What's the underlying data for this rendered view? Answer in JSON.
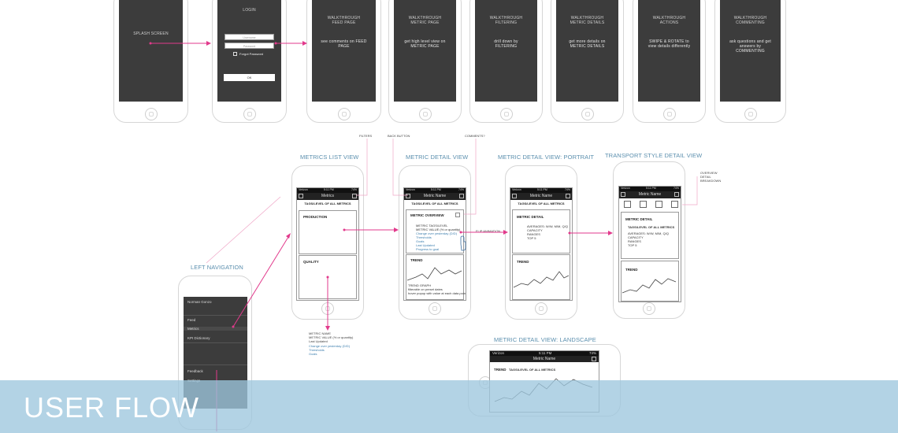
{
  "colors": {
    "arrow": "#e23a8c",
    "label": "#5b8fae",
    "banner": "#9ec7de",
    "link": "#3d7fae"
  },
  "walkthrough": [
    {
      "t1": "SPLASH SCREEN",
      "t2": ""
    },
    {
      "t1": "LOGIN",
      "t2": ""
    },
    {
      "t1": "WALKTHROUGH FEED PAGE",
      "t2": "see comments on FEED PAGE"
    },
    {
      "t1": "WALKTHROUGH METRIC PAGE",
      "t2": "get high level view on METRIC PAGE"
    },
    {
      "t1": "WALKTHROUGH FILTERING",
      "t2": "drill down by FILTERING"
    },
    {
      "t1": "WALKTHROUGH METRIC DETAILS",
      "t2": "get more details on METRIC DETAILS"
    },
    {
      "t1": "WALKTHROUGH ACTIONS",
      "t2": "SWIPE & ROTATE to view details differently"
    },
    {
      "t1": "WALKTHROUGH COMMENTING",
      "t2": "ask questions and get answers by COMMENTING"
    }
  ],
  "login": {
    "username": "Username",
    "password": "Password",
    "forgot": "Forgot Password",
    "ok": "OK"
  },
  "labels": {
    "metrics_list": "METRICS LIST VIEW",
    "metric_detail": "METRIC DETAIL VIEW",
    "detail_portrait": "METRIC DETAIL VIEW: PORTRAIT",
    "transport": "TRANSPORT STYLE DETAIL VIEW",
    "left_nav": "LEFT NAVIGATION",
    "landscape": "METRIC DETAIL VIEW:  LANDSCAPE"
  },
  "callouts": {
    "filters": "FILTERS",
    "back": "BACK BUTTON",
    "comments": "COMMENTS?",
    "flip": "FLIP ANIMATION",
    "overview1": "OVERVIEW",
    "overview2": "DETAIL",
    "overview3": "BREAKDOWN"
  },
  "screens": {
    "metrics_title": "Metrics",
    "metric_name": "Metric Name",
    "tags": "TAGS/LEVEL OF ALL METRICS",
    "production": "PRODUCTION",
    "quality": "QUALITY",
    "metric_overview": "METRIC OVERVIEW",
    "overview_lines": [
      "METRIC TAGS/LEVEL",
      "METRIC VALUE (% or quantity)",
      "Change over yesterday (D/D)",
      "Thresholds",
      "Goals",
      "Last Updated",
      "Progress to goal"
    ],
    "trend": "TREND",
    "trend_lines": [
      "TREND GRAPH",
      "filterable on preset dates",
      "hover popup with value at each data point"
    ],
    "metric_detail": "METRIC DETAIL",
    "detail_lines": [
      "AVERAGES:  W/W, M/M, Q/Q",
      "CAPACITY",
      "RANGES",
      "TOP 5"
    ],
    "carrier": "Verizon",
    "time": "5:11 PM",
    "battery": "74%"
  },
  "list_notes": [
    "METRIC NAME",
    "METRIC VALUE (% or quantity)",
    "Last Updated",
    "Change over yesterday (D/D)",
    "Thresholds",
    "Goals"
  ],
  "left_nav": {
    "user": "Norman Gonzo",
    "items": [
      "Feed",
      "Metrics",
      "KPI Dictionary"
    ],
    "bottom": [
      "Feedback",
      "Settings"
    ]
  },
  "banner": "USER FLOW"
}
